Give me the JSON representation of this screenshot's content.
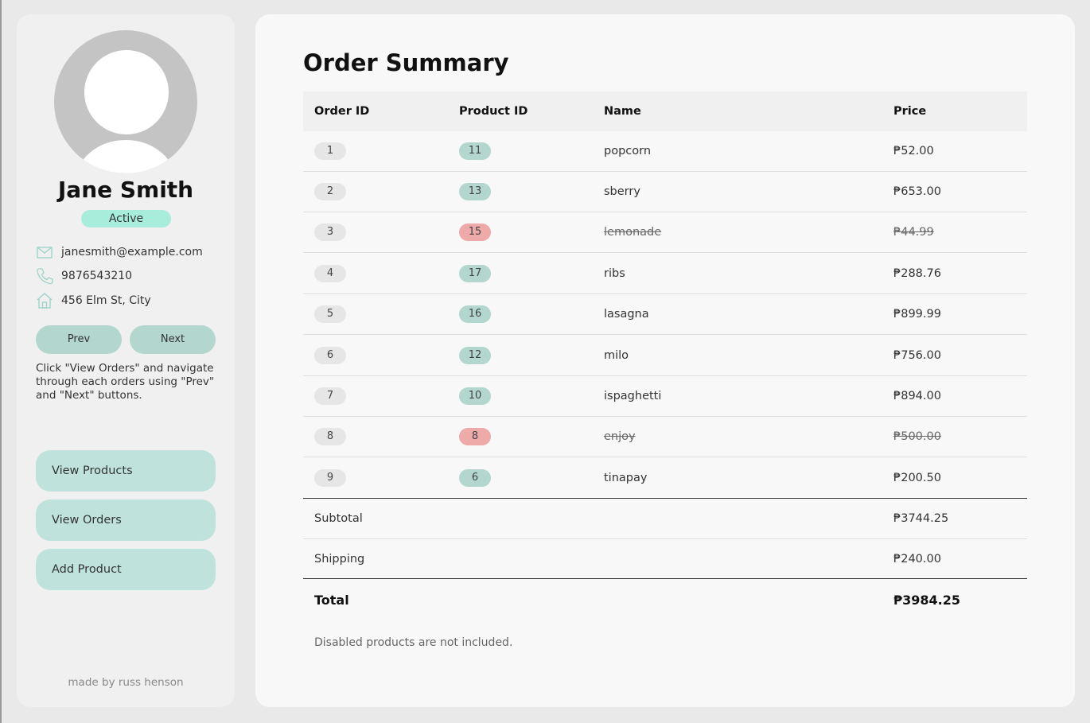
{
  "profile": {
    "name": "Jane Smith",
    "status": "Active",
    "email": "janesmith@example.com",
    "phone": "9876543210",
    "address": "456 Elm St, City"
  },
  "nav": {
    "prev_label": "Prev",
    "next_label": "Next"
  },
  "hint": "Click \"View Orders\" and navigate through each orders using \"Prev\" and \"Next\" buttons.",
  "actions": {
    "view_products": "View Products",
    "view_orders": "View Orders",
    "add_product": "Add Product"
  },
  "credit": "made by russ henson",
  "summary": {
    "title": "Order Summary",
    "columns": [
      "Order ID",
      "Product ID",
      "Name",
      "Price"
    ],
    "rows": [
      {
        "order_id": "1",
        "product_id": "11",
        "name": "popcorn",
        "price": "₱52.00",
        "disabled": false
      },
      {
        "order_id": "2",
        "product_id": "13",
        "name": "sberry",
        "price": "₱653.00",
        "disabled": false
      },
      {
        "order_id": "3",
        "product_id": "15",
        "name": "lemonade",
        "price": "₱44.99",
        "disabled": true
      },
      {
        "order_id": "4",
        "product_id": "17",
        "name": "ribs",
        "price": "₱288.76",
        "disabled": false
      },
      {
        "order_id": "5",
        "product_id": "16",
        "name": "lasagna",
        "price": "₱899.99",
        "disabled": false
      },
      {
        "order_id": "6",
        "product_id": "12",
        "name": "milo",
        "price": "₱756.00",
        "disabled": false
      },
      {
        "order_id": "7",
        "product_id": "10",
        "name": "ispaghetti",
        "price": "₱894.00",
        "disabled": false
      },
      {
        "order_id": "8",
        "product_id": "8",
        "name": "enjoy",
        "price": "₱500.00",
        "disabled": true
      },
      {
        "order_id": "9",
        "product_id": "6",
        "name": "tinapay",
        "price": "₱200.50",
        "disabled": false
      }
    ],
    "subtotal_label": "Subtotal",
    "subtotal_value": "₱3744.25",
    "shipping_label": "Shipping",
    "shipping_value": "₱240.00",
    "total_label": "Total",
    "total_value": "₱3984.25",
    "note": "Disabled products are not included."
  },
  "colors": {
    "accent": "#bfe3dc",
    "badge_active": "#b3d6cf",
    "badge_disabled": "#eea9a9",
    "status_badge": "#a8ecdc"
  },
  "icons": [
    "mail-icon",
    "phone-icon",
    "home-icon"
  ]
}
